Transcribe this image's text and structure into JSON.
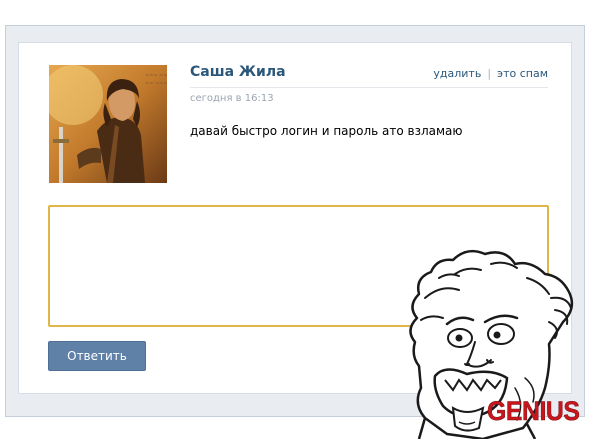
{
  "post": {
    "author": "Саша Жила",
    "time": "сегодня в 16:13",
    "message": "давай быстро логин и пароль ато взламаю",
    "actions": {
      "delete_label": "удалить",
      "separator": "|",
      "spam_label": "это спам"
    }
  },
  "reply": {
    "value": "",
    "button_label": "Ответить"
  },
  "meme": {
    "caption": "GENIUS"
  },
  "colors": {
    "link": "#2b587a",
    "button": "#5f81a8",
    "input_focus_border": "#e0b64a",
    "meme_caption": "#c8161d"
  }
}
